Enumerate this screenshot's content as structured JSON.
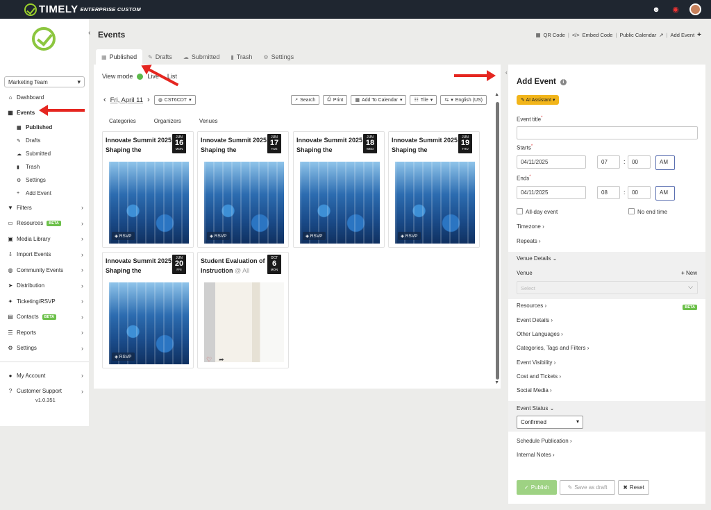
{
  "brand": {
    "name": "TIMELY",
    "subtitle": "ENTERPRISE CUSTOM"
  },
  "sidebar": {
    "team": "Marketing Team",
    "nav": [
      {
        "label": "Dashboard",
        "icon": "home-icon"
      },
      {
        "label": "Events",
        "icon": "calendar-icon",
        "active": true
      },
      {
        "label": "Filters",
        "icon": "filter-icon"
      },
      {
        "label": "Resources",
        "icon": "monitor-icon",
        "badge": "BETA"
      },
      {
        "label": "Media Library",
        "icon": "image-icon"
      },
      {
        "label": "Import Events",
        "icon": "import-icon"
      },
      {
        "label": "Community Events",
        "icon": "globe-icon"
      },
      {
        "label": "Distribution",
        "icon": "send-icon"
      },
      {
        "label": "Ticketing/RSVP",
        "icon": "ticket-icon"
      },
      {
        "label": "Contacts",
        "icon": "contacts-icon",
        "badge": "BETA"
      },
      {
        "label": "Reports",
        "icon": "list-icon"
      },
      {
        "label": "Settings",
        "icon": "gear-icon"
      },
      {
        "label": "My Account",
        "icon": "user-icon"
      },
      {
        "label": "Customer Support",
        "icon": "help-icon"
      }
    ],
    "events_sub": [
      "Published",
      "Drafts",
      "Submitted",
      "Trash",
      "Settings",
      "Add Event"
    ],
    "version": "v1.0.351"
  },
  "header": {
    "title": "Events",
    "toolbar": [
      "QR Code",
      "Embed Code",
      "Public Calendar",
      "Add Event"
    ]
  },
  "tabs": [
    "Published",
    "Drafts",
    "Submitted",
    "Trash",
    "Settings"
  ],
  "main": {
    "view_mode_label": "View mode",
    "view_live": "Live",
    "view_list": "List",
    "date": "Fri, April 11",
    "timezone": "CST6CDT",
    "tools": [
      "Search",
      "Print",
      "Add To Calendar",
      "Tile",
      "English (US)"
    ],
    "filters": [
      "Categories",
      "Organizers",
      "Venues"
    ],
    "events": [
      {
        "title": "Innovate Summit 2025: Shaping the",
        "month": "JUN",
        "day": "16",
        "weekday": "MON",
        "rsvp": "RSVP"
      },
      {
        "title": "Innovate Summit 2025: Shaping the",
        "month": "JUN",
        "day": "17",
        "weekday": "TUE",
        "rsvp": "RSVP"
      },
      {
        "title": "Innovate Summit 2025: Shaping the",
        "month": "JUN",
        "day": "18",
        "weekday": "WED",
        "rsvp": "RSVP"
      },
      {
        "title": "Innovate Summit 2025: Shaping the",
        "month": "JUN",
        "day": "19",
        "weekday": "THU",
        "rsvp": "RSVP"
      },
      {
        "title": "Innovate Summit 2025: Shaping the",
        "month": "JUN",
        "day": "20",
        "weekday": "FRI",
        "rsvp": "RSVP"
      },
      {
        "title": "Student Evaluation of Instruction",
        "suffix": "@ All",
        "month": "OCT",
        "day": "6",
        "weekday": "MON"
      }
    ]
  },
  "panel": {
    "title": "Add Event",
    "ai": "AI Assistant",
    "event_title_label": "Event title",
    "starts_label": "Starts",
    "start_date": "04/11/2025",
    "start_hour": "07",
    "start_min": "00",
    "start_ampm": "AM",
    "ends_label": "Ends",
    "end_date": "04/11/2025",
    "end_hour": "08",
    "end_min": "00",
    "end_ampm": "AM",
    "all_day": "All-day event",
    "no_end": "No end time",
    "timezone": "Timezone",
    "repeats": "Repeats",
    "venue_details": "Venue Details",
    "venue_label": "Venue",
    "venue_new": "New",
    "venue_placeholder": "Select",
    "resources": "Resources",
    "resources_badge": "BETA",
    "links": [
      "Event Details",
      "Other Languages",
      "Categories, Tags and Filters",
      "Event Visibility",
      "Cost and Tickets",
      "Social Media"
    ],
    "event_status": "Event Status",
    "status_value": "Confirmed",
    "schedule": "Schedule Publication",
    "notes": "Internal Notes",
    "publish": "Publish",
    "save_draft": "Save as draft",
    "reset": "Reset"
  }
}
